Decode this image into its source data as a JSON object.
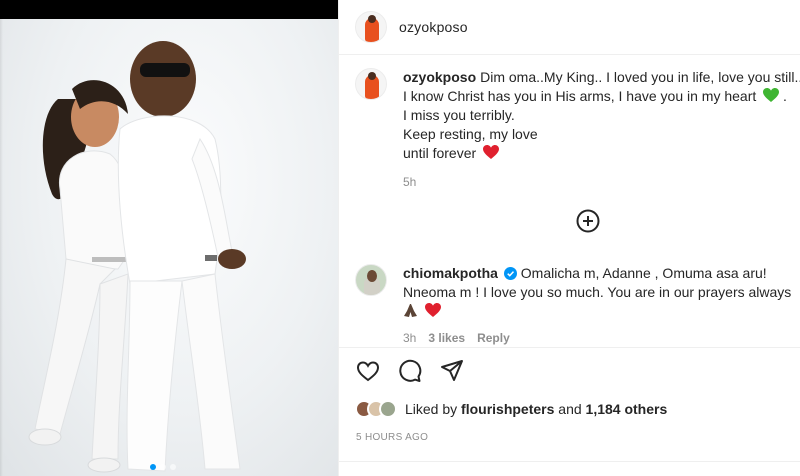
{
  "post": {
    "author": "ozyokposo",
    "caption": {
      "username": "ozyokposo",
      "lines": [
        "Dim oma..My King.. I loved you in life, love you still..",
        "I know Christ has you in His arms, I have you in my heart",
        "I miss you terribly.",
        "Keep resting, my love",
        "until forever"
      ],
      "time": "5h"
    },
    "comments": [
      {
        "username": "chiomakpotha",
        "verified": true,
        "lines": [
          "Omalicha m, Adanne , Omuma asa aru!",
          "Nneoma m ! I love you so much. You are in our prayers always"
        ],
        "time": "3h",
        "likes": "3 likes",
        "reply": "Reply"
      }
    ],
    "liked_by": {
      "prefix": "Liked by",
      "user": "flourishpeters",
      "connector": "and",
      "others": "1,184 others"
    },
    "timestamp": "5 HOURS AGO"
  },
  "icons": {
    "load_more": "plus-circle-icon",
    "like": "heart-outline-icon",
    "comment": "speech-bubble-icon",
    "share": "paper-plane-icon",
    "green_heart": "green-heart-emoji",
    "red_heart": "red-heart-emoji",
    "praying": "praying-hands-emoji",
    "verified": "verified-badge-icon"
  },
  "colors": {
    "text": "#262626",
    "muted": "#8e8e8e",
    "verified": "#0095f6",
    "divider": "#efefef"
  }
}
